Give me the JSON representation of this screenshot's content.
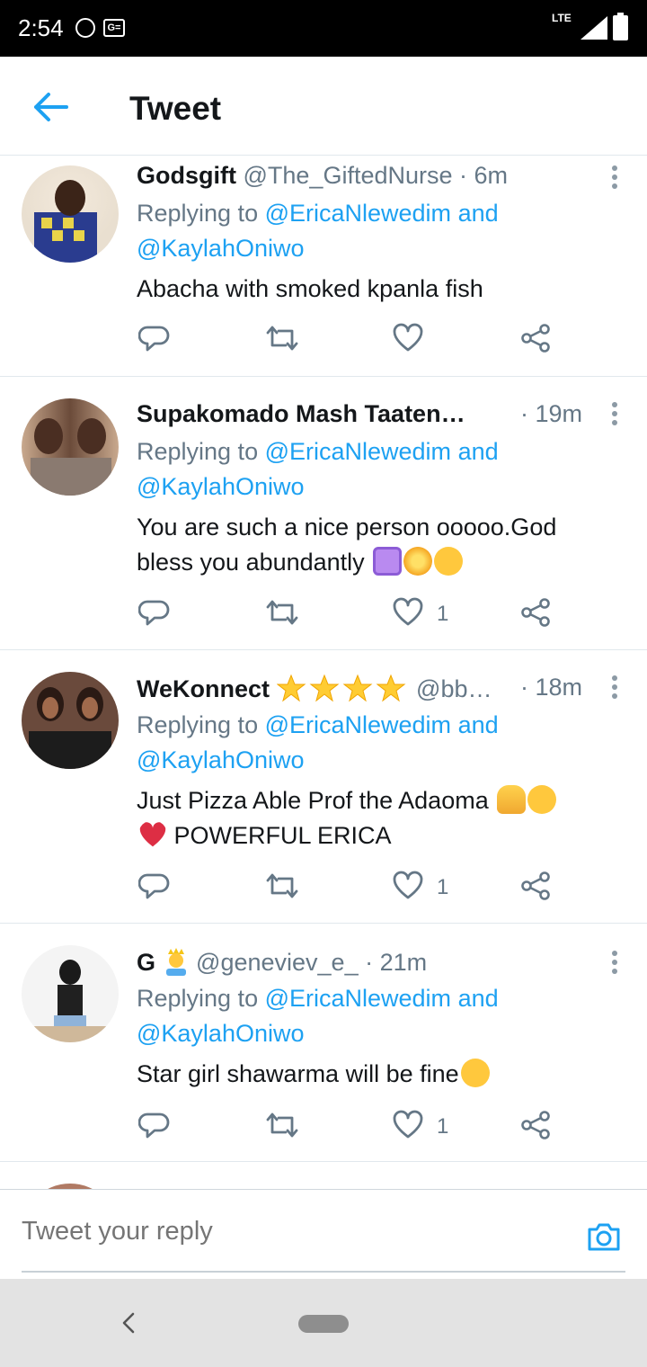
{
  "status_bar": {
    "time": "2:54",
    "network": "LTE",
    "icons": [
      "whatsapp-icon",
      "ge-icon",
      "signal-icon",
      "battery-icon"
    ]
  },
  "app_bar": {
    "title": "Tweet"
  },
  "colors": {
    "accent": "#1da1f2",
    "text": "#14171a",
    "muted": "#657786",
    "divider": "#e1e8ed",
    "heart": "#e0245e"
  },
  "tweets": [
    {
      "name": "Godsgift",
      "handle": "@The_GiftedNurse",
      "time": "· 6m",
      "reply_prefix": "Replying to ",
      "mention1": "@EricaNlewedim",
      "mention_join": " and",
      "mention2": "@KaylahOniwo",
      "text": "Abacha with smoked kpanla fish",
      "likes": ""
    },
    {
      "name": "Supakomado Mash Taaten…",
      "handle": "",
      "time": "· 19m",
      "reply_prefix": "Replying to ",
      "mention1": "@EricaNlewedim",
      "mention_join": " and",
      "mention2": "@KaylahOniwo",
      "text_line1": "You are such a nice person ooooo.God",
      "text_line2": "bless you abundantly",
      "likes": "1"
    },
    {
      "name": "WeKonnect",
      "handle": "@bb…",
      "time": "· 18m",
      "reply_prefix": "Replying to ",
      "mention1": "@EricaNlewedim",
      "mention_join": " and",
      "mention2": "@KaylahOniwo",
      "text_line1": "Just Pizza Able Prof the Adaoma",
      "text_line2": "POWERFUL ERICA",
      "likes": "1"
    },
    {
      "name": "G",
      "handle": "@geneviev_e_",
      "time": "· 21m",
      "reply_prefix": "Replying to ",
      "mention1": "@EricaNlewedim",
      "mention_join": " and",
      "mention2": "@KaylahOniwo",
      "text": "Star girl shawarma will be fine",
      "likes": "1"
    }
  ],
  "composer": {
    "placeholder": "Tweet your reply"
  }
}
